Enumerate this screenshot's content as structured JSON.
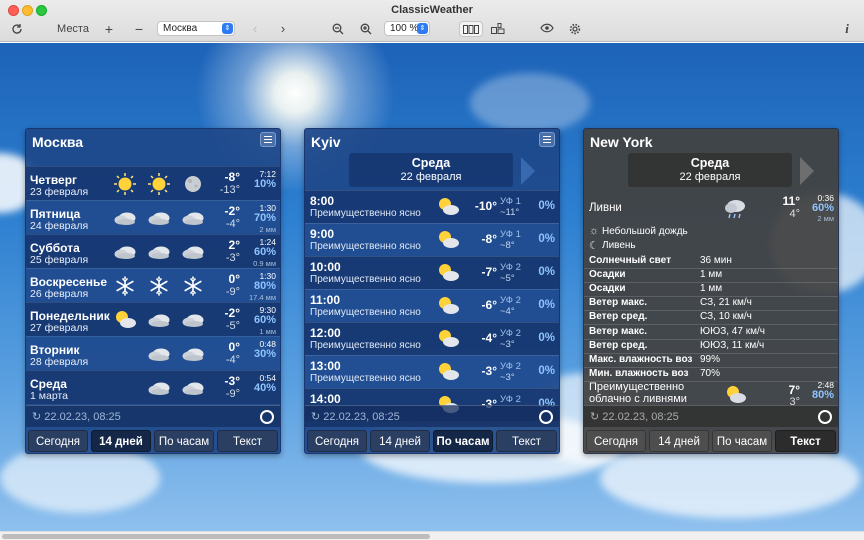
{
  "window": {
    "title": "ClassicWeather"
  },
  "toolbar": {
    "places_label": "Места",
    "add_label": "+",
    "remove_label": "−",
    "location_value": "Москва",
    "zoom_value": "100 %"
  },
  "panels": [
    {
      "city": "Москва",
      "updated": "22.02.23, 08:25",
      "tabs": [
        "Сегодня",
        "14 дней",
        "По часам",
        "Текст"
      ],
      "active_tab": "14 дней",
      "days": [
        {
          "name": "Четверг",
          "date": "23 февраля",
          "icons": [
            "sun",
            "sun",
            "moon"
          ],
          "tmax": "-8°",
          "tmin": "-13°",
          "sunrise": "7:12",
          "precip_pct": "10%",
          "precip_mm": ""
        },
        {
          "name": "Пятница",
          "date": "24 февраля",
          "icons": [
            "cloud",
            "cloud",
            "cloud"
          ],
          "tmax": "-2°",
          "tmin": "-4°",
          "sunrise": "1:30",
          "precip_pct": "70%",
          "precip_mm": "2 мм"
        },
        {
          "name": "Суббота",
          "date": "25 февраля",
          "icons": [
            "cloud",
            "cloud",
            "cloud"
          ],
          "tmax": "2°",
          "tmin": "-3°",
          "sunrise": "1:24",
          "precip_pct": "60%",
          "precip_mm": "0.9 мм"
        },
        {
          "name": "Воскресенье",
          "date": "26 февраля",
          "icons": [
            "snow",
            "snow",
            "snow"
          ],
          "tmax": "0°",
          "tmin": "-9°",
          "sunrise": "1:30",
          "precip_pct": "80%",
          "precip_mm": "17.4 мм"
        },
        {
          "name": "Понедельник",
          "date": "27 февраля",
          "icons": [
            "sun-cloud",
            "cloud",
            "cloud"
          ],
          "tmax": "-2°",
          "tmin": "-5°",
          "sunrise": "9:30",
          "precip_pct": "60%",
          "precip_mm": "1 мм"
        },
        {
          "name": "Вторник",
          "date": "28 февраля",
          "icons": [
            "",
            "cloud",
            "cloud"
          ],
          "tmax": "0°",
          "tmin": "-4°",
          "sunrise": "0:48",
          "precip_pct": "30%",
          "precip_mm": ""
        },
        {
          "name": "Среда",
          "date": "1 марта",
          "icons": [
            "",
            "cloud",
            "cloud"
          ],
          "tmax": "-3°",
          "tmin": "-9°",
          "sunrise": "0:54",
          "precip_pct": "40%",
          "precip_mm": ""
        }
      ]
    },
    {
      "city": "Kyiv",
      "updated": "22.02.23, 08:25",
      "tabs": [
        "Сегодня",
        "14 дней",
        "По часам",
        "Текст"
      ],
      "active_tab": "По часам",
      "day_header": {
        "day": "Среда",
        "date": "22 февраля"
      },
      "hours": [
        {
          "time": "8:00",
          "desc": "Преимущественно ясно",
          "temp": "-10°",
          "wind_dir": "УФ 1",
          "wind_val": "~11°",
          "pct": "0%"
        },
        {
          "time": "9:00",
          "desc": "Преимущественно ясно",
          "temp": "-8°",
          "wind_dir": "УФ 1",
          "wind_val": "~8°",
          "pct": "0%"
        },
        {
          "time": "10:00",
          "desc": "Преимущественно ясно",
          "temp": "-7°",
          "wind_dir": "УФ 2",
          "wind_val": "~5°",
          "pct": "0%"
        },
        {
          "time": "11:00",
          "desc": "Преимущественно ясно",
          "temp": "-6°",
          "wind_dir": "УФ 2",
          "wind_val": "~4°",
          "pct": "0%"
        },
        {
          "time": "12:00",
          "desc": "Преимущественно ясно",
          "temp": "-4°",
          "wind_dir": "УФ 2",
          "wind_val": "~3°",
          "pct": "0%"
        },
        {
          "time": "13:00",
          "desc": "Преимущественно ясно",
          "temp": "-3°",
          "wind_dir": "УФ 2",
          "wind_val": "~3°",
          "pct": "0%"
        },
        {
          "time": "14:00",
          "desc": "",
          "temp": "-3°",
          "wind_dir": "УФ 2",
          "wind_val": "",
          "pct": "0%"
        }
      ]
    },
    {
      "city": "New York",
      "updated": "22.02.23, 08:25",
      "tabs": [
        "Сегодня",
        "14 дней",
        "По часам",
        "Текст"
      ],
      "active_tab": "Текст",
      "day_header": {
        "day": "Среда",
        "date": "22 февраля"
      },
      "summary": {
        "condition": "Ливни",
        "tmax": "11°",
        "tmin": "4°",
        "sunrise": "0:36",
        "pct": "60%",
        "mm": "2 мм"
      },
      "lines": [
        {
          "icon": "sun",
          "text": "Небольшой дождь"
        },
        {
          "icon": "moon",
          "text": "Ливень"
        }
      ],
      "details": [
        {
          "label": "Солнечный свет",
          "value": "36 мин"
        },
        {
          "label": "Осадки",
          "value": "1 мм"
        },
        {
          "label": "Осадки",
          "value": "1 мм"
        },
        {
          "label": "Ветер макс.",
          "value": "СЗ, 21 км/ч"
        },
        {
          "label": "Ветер сред.",
          "value": "СЗ, 10 км/ч"
        },
        {
          "label": "Ветер макс.",
          "value": "ЮЮЗ, 47 км/ч"
        },
        {
          "label": "Ветер сред.",
          "value": "ЮЮЗ, 11 км/ч"
        },
        {
          "label": "Макс. влажность воз",
          "value": "99%"
        },
        {
          "label": "Мин. влажность воз",
          "value": "70%"
        }
      ],
      "next": {
        "condition_line1": "Преимущественно",
        "condition_line2": "облачно с ливнями",
        "tmax": "7°",
        "tmin": "3°",
        "sunrise": "2:48",
        "pct": "80%"
      }
    }
  ]
}
